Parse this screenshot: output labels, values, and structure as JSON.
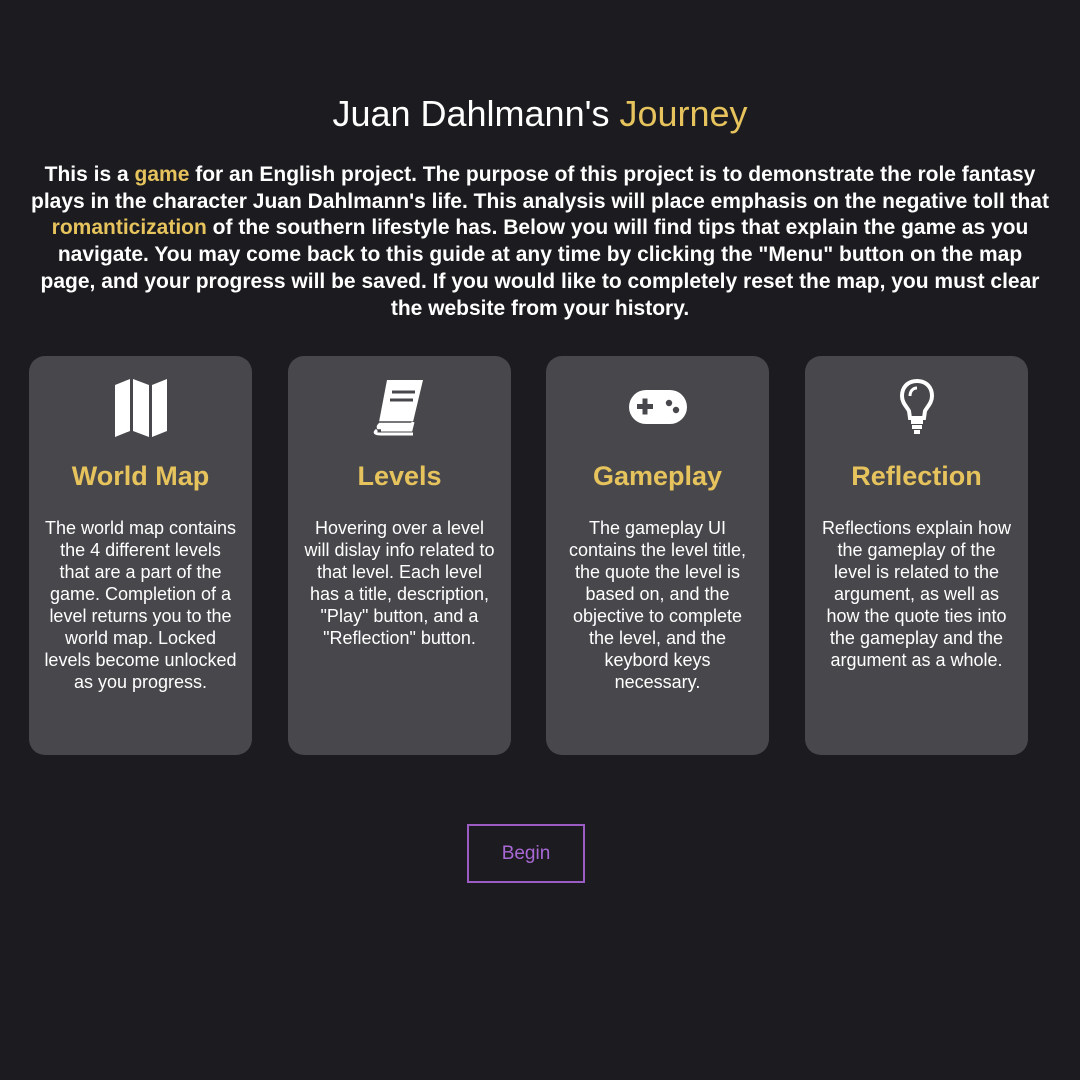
{
  "header": {
    "title_main": "Juan Dahlmann's ",
    "title_accent": "Journey"
  },
  "intro": {
    "part1": "This is a ",
    "link_game": "game",
    "part2": " for an English project. The purpose of this project is to demonstrate the role fantasy plays in the character Juan Dahlmann's life. This analysis will place emphasis on the negative toll that ",
    "link_romanticization": "romanticization",
    "part3": " of the southern lifestyle has. Below you will find tips that explain the game as you navigate. You may come back to this guide at any time by clicking the \"Menu\" button on the map page, and your progress will be saved. If you would like to completely reset the map, you must clear the website from your history."
  },
  "cards": [
    {
      "icon": "map-icon",
      "title": "World Map",
      "description": "The world map contains the 4 different levels that are a part of the game. Completion of a level returns you to the world map. Locked levels become unlocked as you progress."
    },
    {
      "icon": "book-icon",
      "title": "Levels",
      "description": "Hovering over a level will dislay info related to that level. Each level has a title, description, \"Play\" button, and a \"Reflection\" button."
    },
    {
      "icon": "gamepad-icon",
      "title": "Gameplay",
      "description": "The gameplay UI contains the level title, the quote the level is based on, and the objective to complete the level, and the keybord keys necessary."
    },
    {
      "icon": "lightbulb-icon",
      "title": "Reflection",
      "description": "Reflections explain how the gameplay of the level is related to the argument, as well as how the quote ties into the gameplay and the argument as a whole."
    }
  ],
  "begin_button": {
    "label": "Begin"
  },
  "colors": {
    "background": "#1c1c20",
    "card": "#48484c",
    "accent": "#e6c35c",
    "button_border": "#9b5cc4"
  }
}
